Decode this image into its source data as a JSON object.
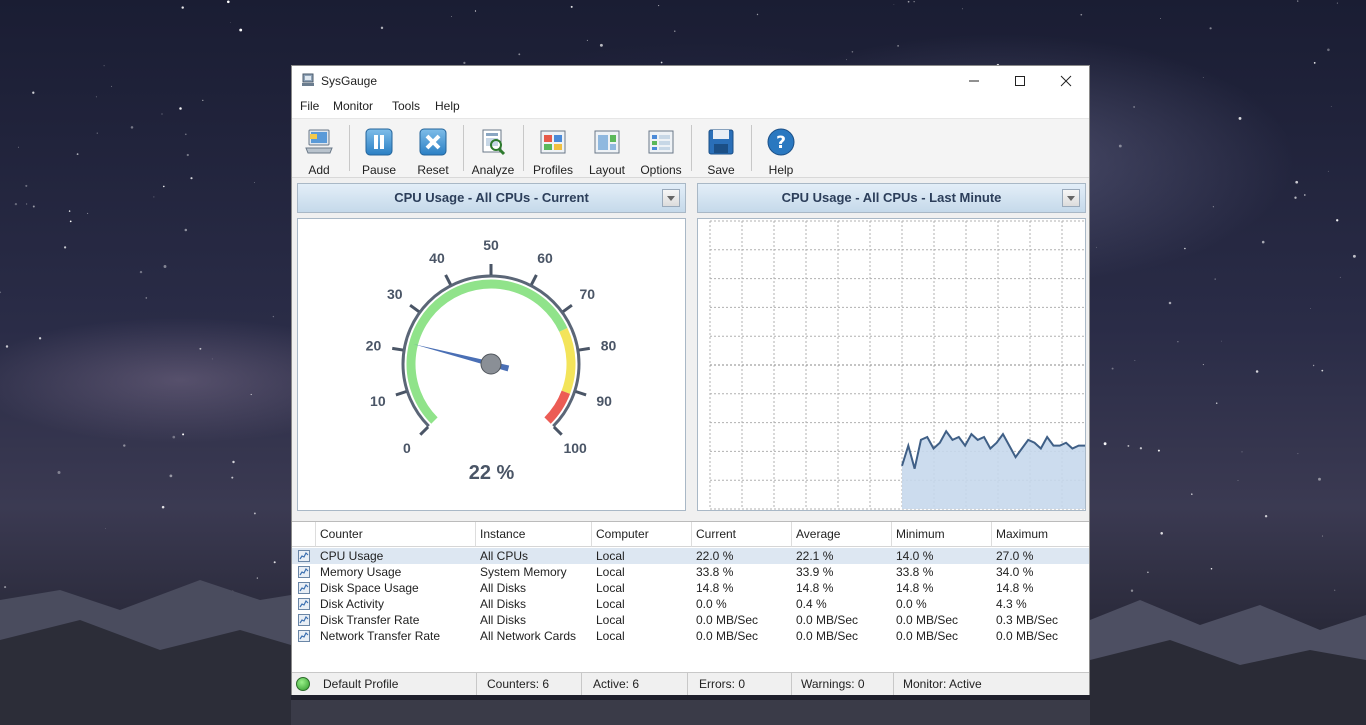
{
  "window": {
    "title": "SysGauge"
  },
  "menu": [
    "File",
    "Monitor",
    "Tools",
    "Help"
  ],
  "toolbar": [
    {
      "label": "Add",
      "icon": "add-computer-icon"
    },
    {
      "label": "Pause",
      "icon": "pause-icon"
    },
    {
      "label": "Reset",
      "icon": "reset-icon"
    },
    {
      "label": "Analyze",
      "icon": "analyze-icon"
    },
    {
      "label": "Profiles",
      "icon": "profiles-icon"
    },
    {
      "label": "Layout",
      "icon": "layout-icon"
    },
    {
      "label": "Options",
      "icon": "options-icon"
    },
    {
      "label": "Save",
      "icon": "save-icon"
    },
    {
      "label": "Help",
      "icon": "help-icon"
    }
  ],
  "gauge_panel": {
    "title": "CPU Usage - All CPUs - Current",
    "value": 22,
    "value_text": "22 %",
    "min": 0,
    "max": 100,
    "ticks": [
      "0",
      "10",
      "20",
      "30",
      "40",
      "50",
      "60",
      "70",
      "80",
      "90",
      "100"
    ],
    "colors": {
      "green": "#90e38a",
      "yellow": "#f3e45a",
      "red": "#ec5c55",
      "needle": "#4a6fb5"
    }
  },
  "chart_panel": {
    "title": "CPU Usage - All CPUs - Last Minute"
  },
  "chart_data": {
    "type": "area",
    "ylim": [
      0,
      100
    ],
    "values": [
      15,
      22,
      14,
      24,
      25,
      21,
      23,
      27,
      24,
      25,
      22,
      26,
      24,
      25,
      21,
      23,
      26,
      22,
      18,
      21,
      24,
      23,
      21,
      25,
      22,
      22,
      23,
      21,
      22,
      22
    ]
  },
  "table": {
    "columns": [
      "Counter",
      "Instance",
      "Computer",
      "Current",
      "Average",
      "Minimum",
      "Maximum"
    ],
    "rows": [
      {
        "counter": "CPU Usage",
        "instance": "All CPUs",
        "computer": "Local",
        "current": "22.0 %",
        "average": "22.1 %",
        "minimum": "14.0 %",
        "maximum": "27.0 %",
        "icon": "cpu-chart-icon",
        "selected": true
      },
      {
        "counter": "Memory Usage",
        "instance": "System Memory",
        "computer": "Local",
        "current": "33.8 %",
        "average": "33.9 %",
        "minimum": "33.8 %",
        "maximum": "34.0 %",
        "icon": "memory-chart-icon",
        "selected": false
      },
      {
        "counter": "Disk Space Usage",
        "instance": "All Disks",
        "computer": "Local",
        "current": "14.8 %",
        "average": "14.8 %",
        "minimum": "14.8 %",
        "maximum": "14.8 %",
        "icon": "disk-chart-icon",
        "selected": false
      },
      {
        "counter": "Disk Activity",
        "instance": "All Disks",
        "computer": "Local",
        "current": "0.0 %",
        "average": "0.4 %",
        "minimum": "0.0 %",
        "maximum": "4.3 %",
        "icon": "disk-activity-icon",
        "selected": false
      },
      {
        "counter": "Disk Transfer Rate",
        "instance": "All Disks",
        "computer": "Local",
        "current": "0.0 MB/Sec",
        "average": "0.0 MB/Sec",
        "minimum": "0.0 MB/Sec",
        "maximum": "0.3 MB/Sec",
        "icon": "disk-transfer-icon",
        "selected": false
      },
      {
        "counter": "Network Transfer Rate",
        "instance": "All Network Cards",
        "computer": "Local",
        "current": "0.0 MB/Sec",
        "average": "0.0 MB/Sec",
        "minimum": "0.0 MB/Sec",
        "maximum": "0.0 MB/Sec",
        "icon": "network-transfer-icon",
        "selected": false
      }
    ]
  },
  "status": {
    "profile": "Default Profile",
    "counters": "Counters: 6",
    "active": "Active: 6",
    "errors": "Errors: 0",
    "warnings": "Warnings: 0",
    "monitor": "Monitor: Active"
  }
}
